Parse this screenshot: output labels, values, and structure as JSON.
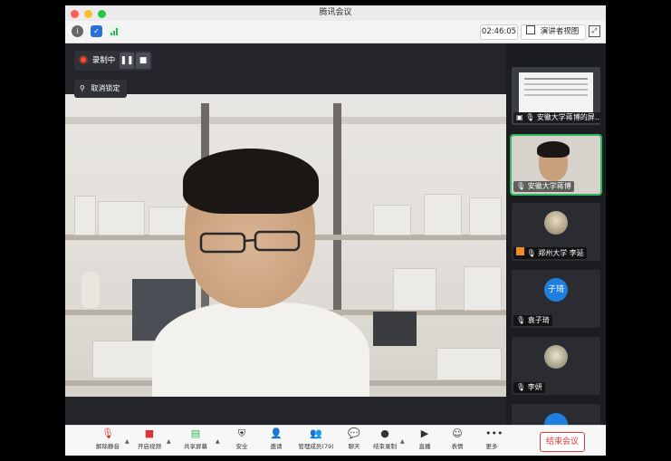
{
  "window": {
    "title": "腾讯会议"
  },
  "infobar": {
    "timer": "02:46:05",
    "view_mode": "演讲者视图"
  },
  "recording": {
    "status": "录制中"
  },
  "pin": {
    "label": "取消锁定"
  },
  "participants": [
    {
      "name": "安徽大学蒋博的屏...",
      "type": "screen",
      "active": false
    },
    {
      "name": "安徽大学蒋博",
      "type": "video",
      "active": true
    },
    {
      "name": "郑州大学 李延",
      "type": "photo"
    },
    {
      "name": "袁子琦",
      "type": "initials",
      "initials": "子琦",
      "color": "#1f7fe0"
    },
    {
      "name": "李妍",
      "type": "photo"
    }
  ],
  "toolbar": {
    "items": [
      {
        "label": "解除静音",
        "icon": "mic-muted-icon"
      },
      {
        "label": "开启视频",
        "icon": "camera-off-icon"
      },
      {
        "label": "共享屏幕",
        "icon": "share-screen-icon"
      },
      {
        "label": "安全",
        "icon": "shield-icon"
      },
      {
        "label": "邀请",
        "icon": "invite-icon"
      },
      {
        "label": "管理成员(79)",
        "icon": "members-icon"
      },
      {
        "label": "聊天",
        "icon": "chat-icon"
      },
      {
        "label": "结束录制",
        "icon": "record-stop-icon"
      },
      {
        "label": "直播",
        "icon": "live-icon"
      },
      {
        "label": "表情",
        "icon": "emoji-icon"
      },
      {
        "label": "更多",
        "icon": "more-icon"
      }
    ],
    "end_meeting": "结束会议"
  },
  "colors": {
    "accent_green": "#2fb85a",
    "danger_red": "#e23a3a",
    "recording_red": "#ff4a2a"
  }
}
